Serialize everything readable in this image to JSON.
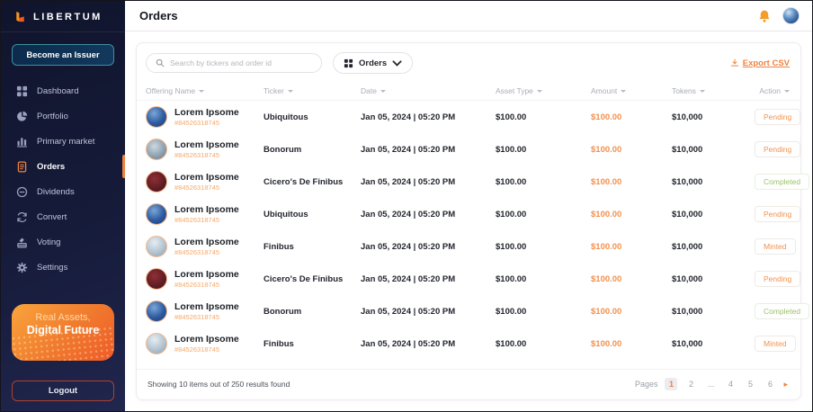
{
  "brand": {
    "name": "LIBERTUM"
  },
  "sidebar": {
    "issuer_button_label": "Become an Issuer",
    "items": [
      {
        "label": "Dashboard",
        "icon": "dashboard-icon",
        "active": false
      },
      {
        "label": "Portfolio",
        "icon": "portfolio-icon",
        "active": false
      },
      {
        "label": "Primary market",
        "icon": "primary-market-icon",
        "active": false
      },
      {
        "label": "Orders",
        "icon": "orders-icon",
        "active": true
      },
      {
        "label": "Dividends",
        "icon": "dividends-icon",
        "active": false
      },
      {
        "label": "Convert",
        "icon": "convert-icon",
        "active": false
      },
      {
        "label": "Voting",
        "icon": "voting-icon",
        "active": false
      },
      {
        "label": "Settings",
        "icon": "settings-icon",
        "active": false
      }
    ],
    "promo": {
      "line1": "Real Assets,",
      "line2": "Digital Future"
    },
    "logout_label": "Logout"
  },
  "header": {
    "title": "Orders"
  },
  "toolbar": {
    "search_placeholder": "Search by tickers and order id",
    "filter_label": "Orders",
    "export_label": "Export CSV"
  },
  "table": {
    "columns": [
      "Offering Name",
      "Ticker",
      "Date",
      "Asset Type",
      "Amount",
      "Tokens",
      "Action"
    ],
    "rows": [
      {
        "name": "Lorem Ipsome",
        "id": "#84526318745",
        "ticker": "Ubiquitous",
        "date": "Jan 05, 2024 | 05:20 PM",
        "asset_type": "$100.00",
        "amount": "$100.00",
        "tokens": "$10,000",
        "action": "Pending",
        "action_type": "pending",
        "avatar": "blue"
      },
      {
        "name": "Lorem Ipsome",
        "id": "#84526318745",
        "ticker": "Bonorum",
        "date": "Jan 05, 2024 | 05:20 PM",
        "asset_type": "$100.00",
        "amount": "$100.00",
        "tokens": "$10,000",
        "action": "Pending",
        "action_type": "pending",
        "avatar": "gray"
      },
      {
        "name": "Lorem Ipsome",
        "id": "#84526318745",
        "ticker": "Cicero's De Finibus",
        "date": "Jan 05, 2024 | 05:20 PM",
        "asset_type": "$100.00",
        "amount": "$100.00",
        "tokens": "$10,000",
        "action": "Completed",
        "action_type": "completed",
        "avatar": "red"
      },
      {
        "name": "Lorem Ipsome",
        "id": "#84526318745",
        "ticker": "Ubiquitous",
        "date": "Jan 05, 2024 | 05:20 PM",
        "asset_type": "$100.00",
        "amount": "$100.00",
        "tokens": "$10,000",
        "action": "Pending",
        "action_type": "pending",
        "avatar": "blue"
      },
      {
        "name": "Lorem Ipsome",
        "id": "#84526318745",
        "ticker": "Finibus",
        "date": "Jan 05, 2024 | 05:20 PM",
        "asset_type": "$100.00",
        "amount": "$100.00",
        "tokens": "$10,000",
        "action": "Minted",
        "action_type": "minted",
        "avatar": "light"
      },
      {
        "name": "Lorem Ipsome",
        "id": "#84526318745",
        "ticker": "Cicero's De Finibus",
        "date": "Jan 05, 2024 | 05:20 PM",
        "asset_type": "$100.00",
        "amount": "$100.00",
        "tokens": "$10,000",
        "action": "Pending",
        "action_type": "pending",
        "avatar": "red"
      },
      {
        "name": "Lorem Ipsome",
        "id": "#84526318745",
        "ticker": "Bonorum",
        "date": "Jan 05, 2024 | 05:20 PM",
        "asset_type": "$100.00",
        "amount": "$100.00",
        "tokens": "$10,000",
        "action": "Completed",
        "action_type": "completed",
        "avatar": "blue"
      },
      {
        "name": "Lorem Ipsome",
        "id": "#84526318745",
        "ticker": "Finibus",
        "date": "Jan 05, 2024 | 05:20 PM",
        "asset_type": "$100.00",
        "amount": "$100.00",
        "tokens": "$10,000",
        "action": "Minted",
        "action_type": "minted",
        "avatar": "light"
      }
    ]
  },
  "footer": {
    "summary": "Showing 10 items out of 250 results found",
    "pages_label": "Pages",
    "pages": [
      "1",
      "2",
      "...",
      "4",
      "5",
      "6"
    ],
    "active_page": "1",
    "next_arrow": "▸"
  },
  "colors": {
    "accent_orange": "#f0823f",
    "amount_orange": "#f2914f",
    "status_green": "#9dc269",
    "sidebar_bg": "#141937"
  }
}
